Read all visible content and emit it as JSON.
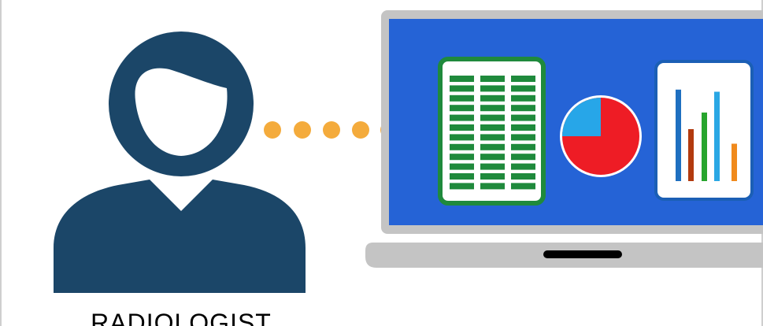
{
  "caption": {
    "text": "RADIOLOGIST"
  },
  "colors": {
    "person": "#1b4668",
    "arrow": "#f4ab3c",
    "screen": "#2563d6",
    "laptop_body": "#c4c4c4",
    "spreadsheet_border": "#1f8a3c",
    "pie_main": "#ee1c25",
    "pie_slice": "#27a6e8",
    "bar_colors": [
      "#1e6fc0",
      "#b23a0e",
      "#27a52d",
      "#2aa7e4",
      "#f08a1c"
    ]
  },
  "icons": [
    "person-icon",
    "dotted-arrow-icon",
    "laptop-icon",
    "spreadsheet-icon",
    "pie-chart-icon",
    "bar-chart-icon"
  ],
  "pie_chart": {
    "slice_fraction": 0.25
  },
  "bar_chart": {
    "values": [
      0.88,
      0.5,
      0.66,
      0.86,
      0.36
    ]
  }
}
